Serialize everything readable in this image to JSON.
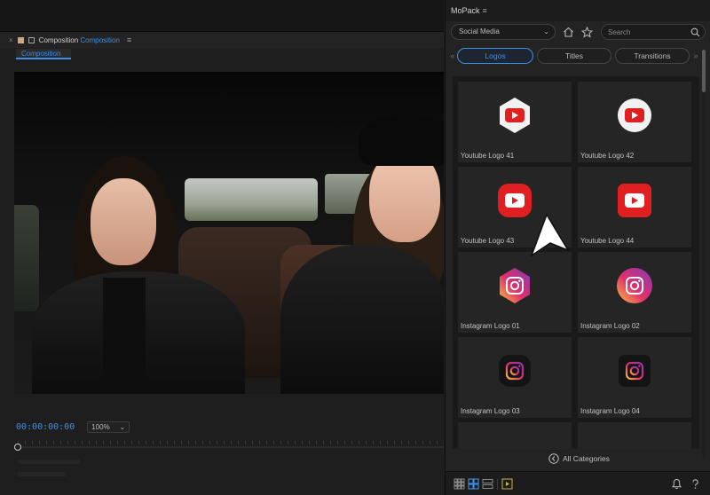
{
  "composition_panel": {
    "tab": {
      "title": "Composition",
      "title_accent": "Composition",
      "subtab": "Composition"
    },
    "timecode": "00:00:00:00",
    "zoom": "100%"
  },
  "mopack": {
    "title": "MoPack",
    "category": "Social Media",
    "search_placeholder": "Search",
    "tabs": [
      {
        "label": "Logos",
        "active": true
      },
      {
        "label": "Titles",
        "active": false
      },
      {
        "label": "Transitions",
        "active": false
      }
    ],
    "items": [
      {
        "label": "Youtube Logo 41",
        "icon": "youtube-hexagon-icon"
      },
      {
        "label": "Youtube Logo 42",
        "icon": "youtube-circle-icon"
      },
      {
        "label": "Youtube Logo 43",
        "icon": "youtube-rounded-icon"
      },
      {
        "label": "Youtube Logo 44",
        "icon": "youtube-square-icon"
      },
      {
        "label": "Instagram Logo 01",
        "icon": "instagram-hexagon-icon"
      },
      {
        "label": "Instagram Logo 02",
        "icon": "instagram-circle-icon"
      },
      {
        "label": "Instagram Logo 03",
        "icon": "instagram-dark-icon"
      },
      {
        "label": "Instagram Logo 04",
        "icon": "instagram-dark-square-icon"
      }
    ],
    "all_categories": "All Categories"
  },
  "colors": {
    "accent": "#3d8ee6",
    "youtube_red": "#e02020",
    "panel_bg": "#232323"
  }
}
